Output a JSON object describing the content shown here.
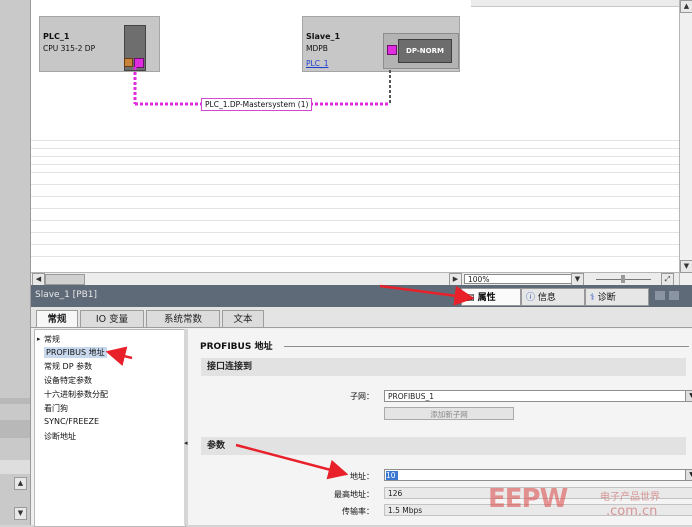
{
  "network_view": {
    "devices": [
      {
        "name": "PLC_1",
        "type": "CPU 315-2 DP",
        "link": ""
      },
      {
        "name": "Slave_1",
        "type": "MDPB",
        "link": "PLC_1"
      }
    ],
    "slave_module_label": "DP-NORM",
    "bus_label": "PLC_1.DP-Mastersystem (1)",
    "zoom": "100%",
    "colors": {
      "profibus": "#e02be0",
      "link": "#1d3fd0"
    }
  },
  "inspector": {
    "title": "Slave_1 [PB1]",
    "tabs": [
      {
        "label": "属性",
        "icon": "properties-icon"
      },
      {
        "label": "信息",
        "icon": "info-icon"
      },
      {
        "label": "诊断",
        "icon": "diagnostics-icon"
      }
    ],
    "subtabs": [
      "常规",
      "IO 变量",
      "系统常数",
      "文本"
    ],
    "nav_items": [
      "常规",
      "PROFIBUS 地址",
      "常规 DP 参数",
      "设备特定参数",
      "十六进制参数分配",
      "看门狗",
      "SYNC/FREEZE",
      "诊断地址"
    ],
    "section_title": "PROFIBUS 地址",
    "interface_group": {
      "title": "接口连接到",
      "subnet_label": "子网：",
      "subnet_value": "PROFIBUS_1",
      "add_subnet_button": "添加新子网"
    },
    "params_group": {
      "title": "参数",
      "address_label": "地址：",
      "address_value": "10",
      "highest_address_label": "最高地址：",
      "highest_address_value": "126",
      "baud_label": "传输率：",
      "baud_value": "1.5 Mbps"
    }
  },
  "watermark": {
    "logo": "EEPW",
    "cn": "电子产品世界",
    "domain": ".com.cn"
  }
}
